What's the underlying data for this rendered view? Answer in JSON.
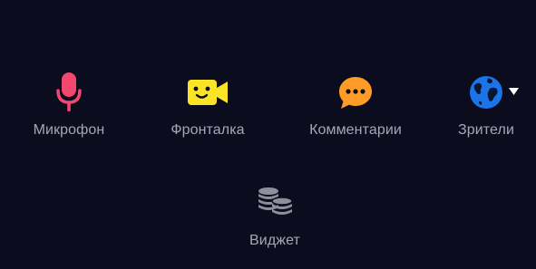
{
  "colors": {
    "background": "#0c0c1f",
    "label": "#a6a7b6",
    "mic": "#f2476f",
    "camera": "#fbe326",
    "comments": "#ff9c28",
    "globe_ocean": "#1b74e8",
    "globe_land": "#0a1630",
    "coins": "#8e8f9a",
    "caret": "#ffffff"
  },
  "controls": {
    "mic": {
      "label": "Микрофон",
      "icon": "microphone-icon"
    },
    "camera": {
      "label": "Фронталка",
      "icon": "front-camera-icon"
    },
    "comments": {
      "label": "Комментарии",
      "icon": "speech-bubble-icon"
    },
    "viewers": {
      "label": "Зрители",
      "icon": "globe-icon"
    },
    "widget": {
      "label": "Виджет",
      "icon": "coins-stack-icon"
    }
  }
}
